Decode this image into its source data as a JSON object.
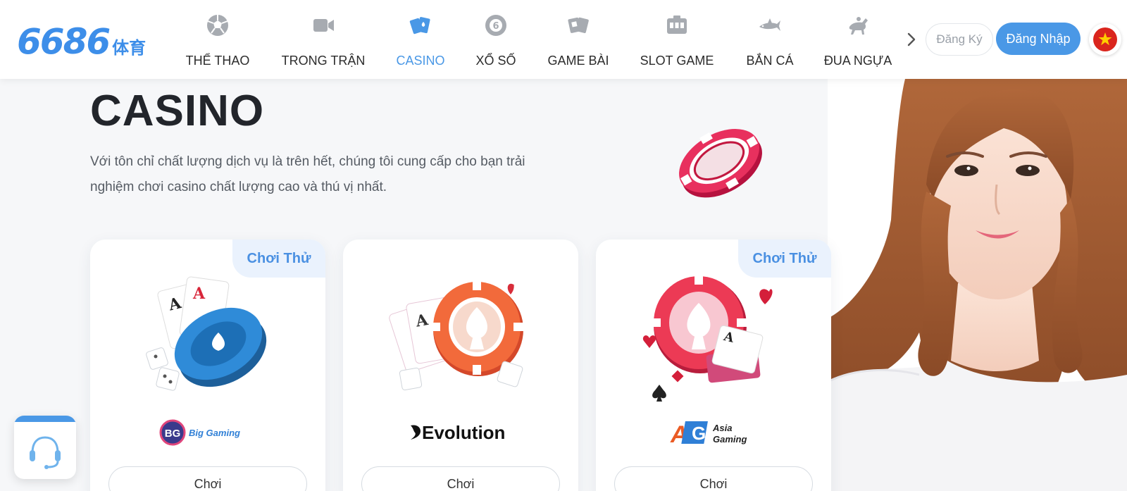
{
  "brand": {
    "logo_text": "6686",
    "logo_suffix": "体育",
    "accent": "#4a98e6"
  },
  "nav": {
    "items": [
      {
        "label": "THỂ THAO",
        "icon": "soccer-ball-icon"
      },
      {
        "label": "TRONG TRẬN",
        "icon": "video-camera-icon"
      },
      {
        "label": "CASINO",
        "icon": "playing-cards-icon",
        "active": true
      },
      {
        "label": "XỔ SỐ",
        "icon": "lottery-ball-icon"
      },
      {
        "label": "GAME BÀI",
        "icon": "card-game-icon"
      },
      {
        "label": "SLOT GAME",
        "icon": "slot-machine-icon"
      },
      {
        "label": "BẮN CÁ",
        "icon": "shark-icon"
      },
      {
        "label": "ĐUA NGỰA",
        "icon": "horse-racing-icon"
      }
    ],
    "next_icon": "chevron-right-icon"
  },
  "auth": {
    "register_label": "Đăng Ký",
    "login_label": "Đăng Nhập"
  },
  "language": {
    "flag": "vietnam-flag-icon"
  },
  "main": {
    "title": "CASINO",
    "description": "Với tôn chỉ chất lượng dịch vụ là trên hết, chúng tôi cung cấp cho bạn trải nghiệm chơi casino chất lượng cao và thú vị nhất."
  },
  "providers": [
    {
      "name": "Big Gaming",
      "logo_mark": "BG",
      "trial_label": "Chơi Thử",
      "play_label": "Chơi"
    },
    {
      "name": "Evolution",
      "trial_label": "",
      "play_label": "Chơi"
    },
    {
      "name": "Asia Gaming",
      "logo_mark": "AG",
      "logo_line1": "Asia",
      "logo_line2": "Gaming",
      "trial_label": "Chơi Thử",
      "play_label": "Chơi"
    }
  ],
  "support": {
    "icon": "headset-icon"
  }
}
